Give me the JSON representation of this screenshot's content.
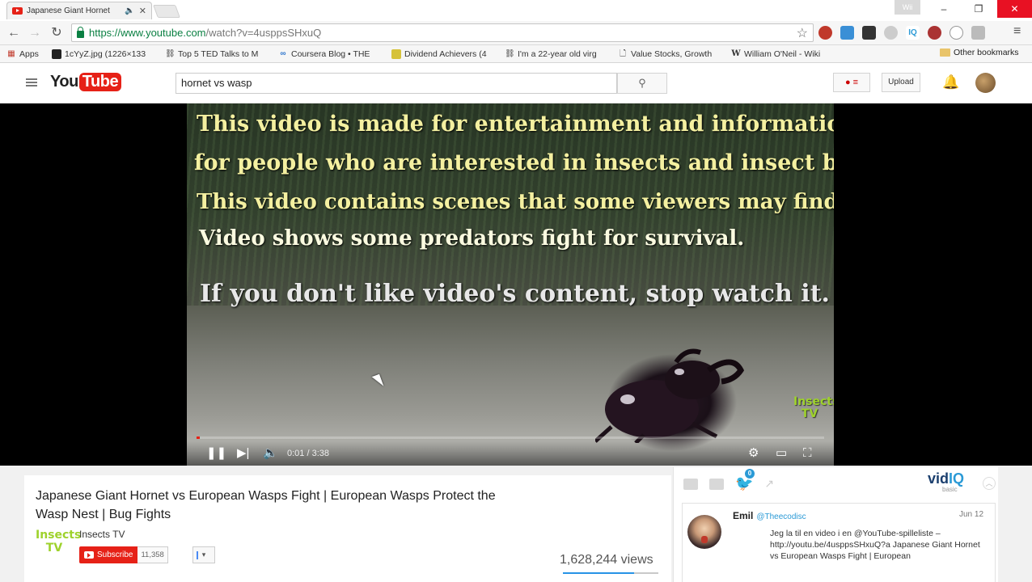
{
  "browser": {
    "tab_title": "Japanese Giant Hornet",
    "url_host": "https://www.youtube.com",
    "url_rest": "/watch?v=4usppsSHxuQ",
    "user_badge": "Wii",
    "bookmarks": [
      {
        "label": "Apps",
        "icon": "apps-icon"
      },
      {
        "label": "1cYyZ.jpg (1226×133",
        "icon": "image-bookmark-icon"
      },
      {
        "label": "Top 5 TED Talks to M",
        "icon": "link-icon"
      },
      {
        "label": "Coursera Blog • THE",
        "icon": "coursera-icon"
      },
      {
        "label": "Dividend Achievers (4",
        "icon": "chart-icon"
      },
      {
        "label": "I'm a 22-year old virg",
        "icon": "link-icon"
      },
      {
        "label": "Value Stocks, Growth",
        "icon": "page-icon"
      },
      {
        "label": "William O'Neil - Wiki",
        "icon": "wikipedia-icon"
      }
    ],
    "other_bookmarks": "Other bookmarks"
  },
  "youtube": {
    "logo_you": "You",
    "logo_tube": "Tube",
    "search_query": "hornet vs wasp",
    "upload_label": "Upload"
  },
  "player": {
    "captions": [
      "This video is made for entertainment and information",
      "for people who are interested in insects and insect battles.",
      "This video contains scenes that some viewers may find disturbing.",
      "Video shows some predators fight for survival.",
      "If you don't like video's content, stop watch it."
    ],
    "watermark": "Insects TV",
    "time_display": "0:01 / 3:38",
    "progress": 0.005
  },
  "video": {
    "title": "Japanese Giant Hornet vs European Wasps Fight | European Wasps Protect the Wasp Nest | Bug Fights",
    "channel_name": "Insects TV",
    "channel_logo": "Insects TV",
    "subscribe_label": "Subscribe",
    "subscriber_count": "11,358",
    "views": "1,628,244 views"
  },
  "vidiq": {
    "logo_vid": "vid",
    "logo_iq": "IQ",
    "logo_sub": "basic",
    "twitter_badge": "0",
    "tweet": {
      "name": "Emil",
      "handle": "@Theecodisc",
      "date": "Jun 12",
      "text": "Jeg la til en video i en @YouTube-spilleliste – http://youtu.be/4usppsSHxuQ?a Japanese Giant Hornet vs European Wasps Fight | European"
    }
  },
  "colors": {
    "youtube_red": "#e62117",
    "caption_yellow": "#f4f0a0",
    "vidiq_blue": "#2b9ad6"
  }
}
